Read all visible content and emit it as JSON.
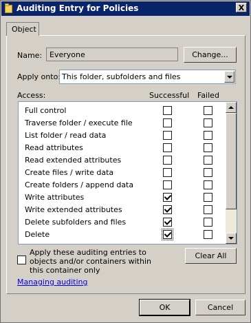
{
  "window": {
    "title": "Auditing Entry for Policies",
    "close_glyph": "X"
  },
  "tabs": [
    {
      "label": "Object"
    }
  ],
  "name": {
    "label": "Name:",
    "value": "Everyone",
    "change_button": "Change..."
  },
  "apply_onto": {
    "label": "Apply onto:",
    "value": "This folder, subfolders and files"
  },
  "columns": {
    "access": "Access:",
    "successful": "Successful",
    "failed": "Failed"
  },
  "entries": [
    {
      "name": "Full control",
      "successful": false,
      "failed": false
    },
    {
      "name": "Traverse folder / execute file",
      "successful": false,
      "failed": false
    },
    {
      "name": "List folder / read data",
      "successful": false,
      "failed": false
    },
    {
      "name": "Read attributes",
      "successful": false,
      "failed": false
    },
    {
      "name": "Read extended attributes",
      "successful": false,
      "failed": false
    },
    {
      "name": "Create files / write data",
      "successful": false,
      "failed": false
    },
    {
      "name": "Create folders / append data",
      "successful": false,
      "failed": false
    },
    {
      "name": "Write attributes",
      "successful": true,
      "failed": false
    },
    {
      "name": "Write extended attributes",
      "successful": true,
      "failed": false
    },
    {
      "name": "Delete subfolders and files",
      "successful": true,
      "failed": false
    },
    {
      "name": "Delete",
      "successful": true,
      "failed": false
    }
  ],
  "apply_option": {
    "label": "Apply these auditing entries to objects and/or containers within this container only",
    "checked": false
  },
  "clear_all_button": "Clear All",
  "help_link": "Managing auditing",
  "footer": {
    "ok": "OK",
    "cancel": "Cancel"
  }
}
